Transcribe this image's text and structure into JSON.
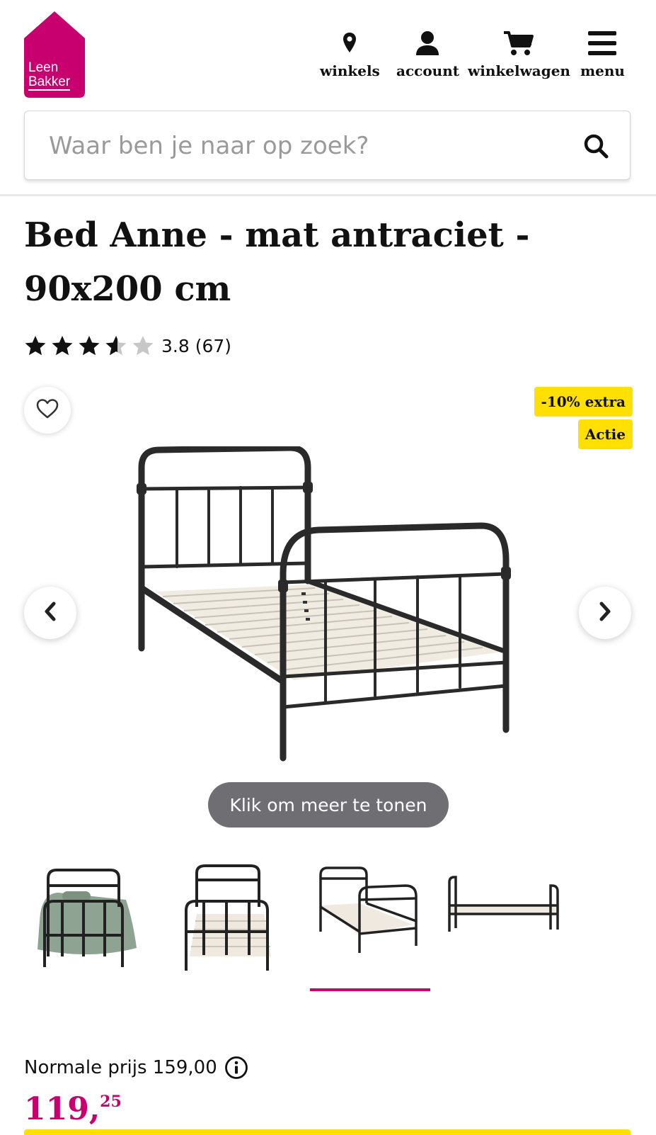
{
  "brand": {
    "logo_line1": "Leen",
    "logo_line2": "Bakker",
    "color": "#c8006f"
  },
  "nav": {
    "stores": "winkels",
    "account": "account",
    "cart": "winkelwagen",
    "menu": "menu"
  },
  "search": {
    "placeholder": "Waar ben je naar op zoek?"
  },
  "product": {
    "title": "Bed Anne - mat antraciet - 90x200 cm",
    "rating_value": 3.8,
    "rating_text": "3.8 (67)",
    "badges": [
      "-10% extra",
      "Actie"
    ],
    "show_more": "Klik om meer te tonen",
    "gallery_selected_index": 2,
    "gallery_count": 4
  },
  "price": {
    "normal_label": "Normale prijs 159,00",
    "euros": "119,",
    "cents": "25"
  },
  "colors": {
    "accent": "#c8006f",
    "badge": "#ffe000",
    "pill": "#6f6f73"
  },
  "icons": [
    "map-pin-icon",
    "user-icon",
    "cart-icon",
    "hamburger-icon",
    "search-icon",
    "heart-icon",
    "chevron-left-icon",
    "chevron-right-icon",
    "info-icon",
    "star-icon"
  ]
}
